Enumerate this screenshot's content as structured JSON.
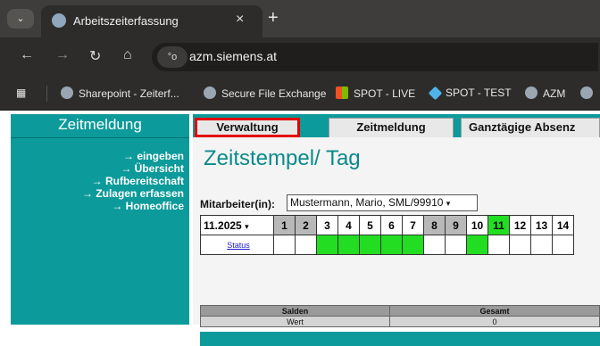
{
  "browser": {
    "tab_title": "Arbeitszeiterfassung",
    "tab_close": "×",
    "new_tab": "+",
    "url": "azm.siemens.at",
    "site_info": "°o",
    "bookmarks": [
      "Sharepoint - Zeiterf...",
      "Secure File Exchange",
      "SPOT - LIVE",
      "SPOT - TEST",
      "AZM"
    ]
  },
  "sidebar": {
    "title": "Zeitmeldung",
    "links": [
      "→ eingeben",
      "→ Übersicht",
      "→ Rufbereitschaft",
      "→ Zulagen erfassen",
      "→ Homeoffice"
    ]
  },
  "tabs": [
    {
      "label": "Verwaltung",
      "highlighted": true
    },
    {
      "label": "Zeitmeldung",
      "highlighted": false
    },
    {
      "label": "Ganztägige Absenz",
      "highlighted": false
    }
  ],
  "content": {
    "heading": "Zeitstempel/ Tag",
    "employee_label": "Mitarbeiter(in):",
    "employee_value": "Mustermann, Mario, SML/99910",
    "month_value": "11.2025",
    "days": [
      "1",
      "2",
      "3",
      "4",
      "5",
      "6",
      "7",
      "8",
      "9",
      "10",
      "11",
      "12",
      "13",
      "14"
    ],
    "status_link": "Status",
    "salden_header": "Salden",
    "gesamt_header": "Gesamt",
    "wert_label": "Wert",
    "wert_value": "0"
  },
  "colors": {
    "teal": "#0d9a9a",
    "green": "#22dd22",
    "highlight": "#e30000"
  }
}
